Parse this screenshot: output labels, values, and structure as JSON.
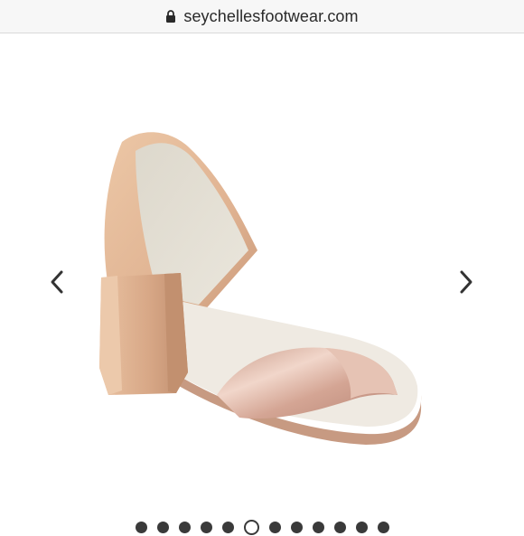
{
  "address_bar": {
    "url": "seychellesfootwear.com",
    "lock_icon": "lock-icon"
  },
  "carousel": {
    "product_image_icon": "sandal-image",
    "prev_icon": "chevron-left-icon",
    "next_icon": "chevron-right-icon",
    "slide_count": 12,
    "active_slide": 6
  },
  "colors": {
    "background": "#ffffff",
    "address_bar_bg": "#f7f7f7",
    "text": "#2a2a2a",
    "dot": "#3a3a3a",
    "shoe_nude": "#e2b795",
    "shoe_metallic": "#d9b2a2"
  }
}
